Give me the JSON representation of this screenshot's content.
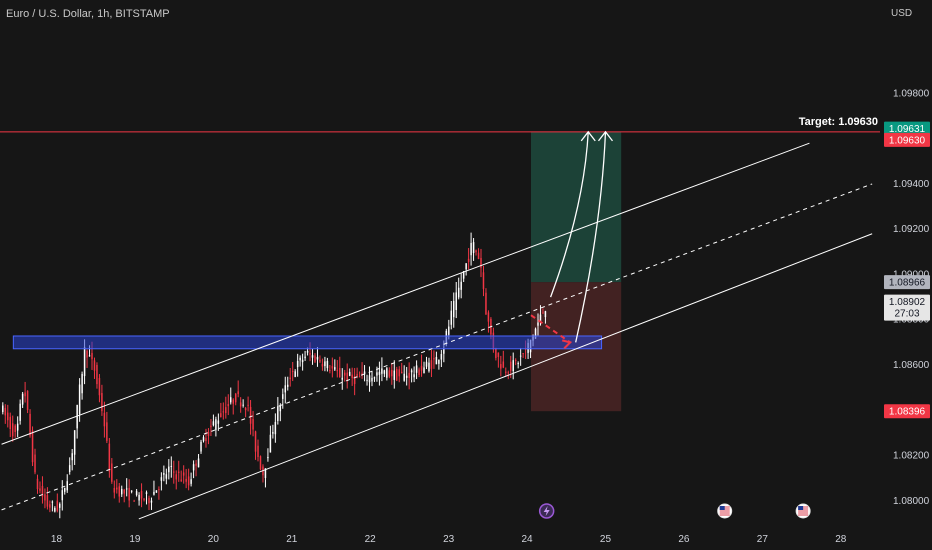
{
  "header": {
    "symbol_title": "Euro / U.S. Dollar, 1h, BITSTAMP",
    "currency": "USD"
  },
  "colors": {
    "background": "#161616",
    "bull": "#ffffff",
    "bear": "#f23645",
    "target_line": "#f23645",
    "support_zone": "#2a44d6",
    "profit_zone": "#1d4a3d",
    "loss_zone": "#4a2424",
    "price_tag_green": "#089981",
    "price_tag_red": "#f23645",
    "price_tag_grey": "#b2b5be",
    "price_tag_white": "#e6e6e6"
  },
  "chart_data": {
    "type": "candlestick",
    "symbol": "Euro / U.S. Dollar",
    "timeframe": "1h",
    "exchange": "BITSTAMP",
    "y_axis": {
      "ticks": [
        1.08,
        1.082,
        1.084,
        1.086,
        1.088,
        1.09,
        1.092,
        1.094,
        1.096,
        1.098
      ],
      "tick_labels": [
        "1.08000",
        "1.08200",
        "1.08400",
        "1.08600",
        "1.08800",
        "1.09000",
        "1.09200",
        "1.09400",
        "1.09600",
        "1.09800"
      ],
      "range": [
        1.0788,
        1.1008
      ]
    },
    "x_axis": {
      "ticks": [
        18,
        19,
        20,
        21,
        22,
        23,
        24,
        25,
        26,
        27,
        28
      ],
      "tick_labels": [
        "18",
        "19",
        "20",
        "21",
        "22",
        "23",
        "24",
        "25",
        "26",
        "27",
        "28"
      ],
      "range": [
        17.28,
        28.5
      ]
    },
    "price_path": [
      {
        "t": 17.3,
        "p": 1.0842
      },
      {
        "t": 17.5,
        "p": 1.0828
      },
      {
        "t": 17.6,
        "p": 1.0852
      },
      {
        "t": 17.75,
        "p": 1.0808
      },
      {
        "t": 17.9,
        "p": 1.0798
      },
      {
        "t": 18.05,
        "p": 1.0797
      },
      {
        "t": 18.2,
        "p": 1.0818
      },
      {
        "t": 18.38,
        "p": 1.0868
      },
      {
        "t": 18.5,
        "p": 1.0858
      },
      {
        "t": 18.62,
        "p": 1.0836
      },
      {
        "t": 18.72,
        "p": 1.0806
      },
      {
        "t": 18.85,
        "p": 1.0804
      },
      {
        "t": 19.0,
        "p": 1.0802
      },
      {
        "t": 19.2,
        "p": 1.0801
      },
      {
        "t": 19.45,
        "p": 1.0814
      },
      {
        "t": 19.7,
        "p": 1.0808
      },
      {
        "t": 19.9,
        "p": 1.0828
      },
      {
        "t": 20.1,
        "p": 1.0838
      },
      {
        "t": 20.3,
        "p": 1.0846
      },
      {
        "t": 20.45,
        "p": 1.0842
      },
      {
        "t": 20.55,
        "p": 1.0824
      },
      {
        "t": 20.65,
        "p": 1.0812
      },
      {
        "t": 20.8,
        "p": 1.0836
      },
      {
        "t": 21.0,
        "p": 1.0856
      },
      {
        "t": 21.2,
        "p": 1.0865
      },
      {
        "t": 21.4,
        "p": 1.0862
      },
      {
        "t": 21.6,
        "p": 1.0856
      },
      {
        "t": 21.8,
        "p": 1.0854
      },
      {
        "t": 22.0,
        "p": 1.0855
      },
      {
        "t": 22.2,
        "p": 1.0857
      },
      {
        "t": 22.4,
        "p": 1.0855
      },
      {
        "t": 22.6,
        "p": 1.0857
      },
      {
        "t": 22.85,
        "p": 1.0862
      },
      {
        "t": 22.95,
        "p": 1.0868
      },
      {
        "t": 23.05,
        "p": 1.0882
      },
      {
        "t": 23.2,
        "p": 1.09
      },
      {
        "t": 23.32,
        "p": 1.0914
      },
      {
        "t": 23.42,
        "p": 1.0906
      },
      {
        "t": 23.5,
        "p": 1.0882
      },
      {
        "t": 23.6,
        "p": 1.0866
      },
      {
        "t": 23.72,
        "p": 1.0858
      },
      {
        "t": 23.85,
        "p": 1.086
      },
      {
        "t": 24.0,
        "p": 1.0866
      },
      {
        "t": 24.1,
        "p": 1.0874
      },
      {
        "t": 24.25,
        "p": 1.0886
      }
    ],
    "target_level": 1.0963,
    "support_zone": {
      "from": 1.08685,
      "to": 1.08715,
      "t_start": 17.45,
      "t_end": 24.95
    },
    "long_position": {
      "t_start": 24.05,
      "t_end": 25.2,
      "entry": 1.08966,
      "target": 1.0963,
      "stop": 1.08396
    },
    "channel": {
      "upper": [
        {
          "t": 17.3,
          "p": 1.0825
        },
        {
          "t": 27.6,
          "p": 1.0958
        }
      ],
      "middle": [
        {
          "t": 17.3,
          "p": 1.0796
        },
        {
          "t": 28.4,
          "p": 1.094
        }
      ],
      "lower": [
        {
          "t": 19.05,
          "p": 1.0792
        },
        {
          "t": 28.4,
          "p": 1.0918
        }
      ]
    },
    "projection_arrows": [
      {
        "from": {
          "t": 24.3,
          "p": 1.089
        },
        "to": {
          "t": 24.78,
          "p": 1.0963
        }
      },
      {
        "from": {
          "t": 24.62,
          "p": 1.087
        },
        "to": {
          "t": 25.0,
          "p": 1.0963
        }
      }
    ],
    "dashed_pullback": [
      {
        "t": 24.05,
        "p": 1.0882
      },
      {
        "t": 24.55,
        "p": 1.087
      }
    ],
    "annotations": {
      "target_label": "Target: 1.09630"
    },
    "price_labels": [
      {
        "text": "1.09631",
        "style": "green",
        "value": 1.09631
      },
      {
        "text": "1.09630",
        "style": "red",
        "value": 1.0963
      },
      {
        "text": "1.08966",
        "style": "grey",
        "value": 1.08966
      },
      {
        "text": "1.08902",
        "style": "white",
        "value": 1.08902,
        "countdown": "27:03"
      },
      {
        "text": "1.08396",
        "style": "red",
        "value": 1.08396
      }
    ],
    "event_markers": [
      {
        "t": 24.25,
        "kind": "lightning"
      },
      {
        "t": 26.52,
        "kind": "us-flag"
      },
      {
        "t": 27.52,
        "kind": "us-flag"
      }
    ],
    "candle_count": 220,
    "seed": 7
  }
}
